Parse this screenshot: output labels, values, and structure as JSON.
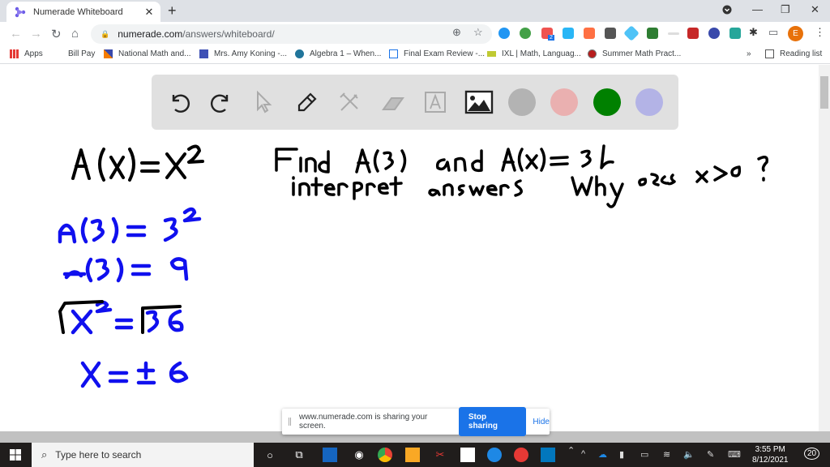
{
  "browser": {
    "tab_title": "Numerade Whiteboard",
    "url_host": "numerade.com",
    "url_path": "/answers/whiteboard/",
    "profile_initial": "E",
    "extension_badge": "2"
  },
  "bookmarks": [
    {
      "label": "Apps",
      "icon": "apps-grid-icon"
    },
    {
      "label": "Bill Pay",
      "icon": ""
    },
    {
      "label": "National Math and...",
      "icon": "national-math-icon"
    },
    {
      "label": "Mrs. Amy Koning -...",
      "icon": "calendar-icon"
    },
    {
      "label": "Algebra 1 – When...",
      "icon": "wordpress-icon"
    },
    {
      "label": "Final Exam Review -...",
      "icon": "forms-icon"
    },
    {
      "label": "IXL | Math, Languag...",
      "icon": "ixl-icon"
    },
    {
      "label": "Summer Math Pract...",
      "icon": "summer-math-icon"
    }
  ],
  "bookmarks_overflow": "»",
  "reading_list": "Reading list",
  "whiteboard": {
    "tools": [
      "undo",
      "redo",
      "select",
      "pen",
      "tools",
      "eraser",
      "text",
      "image"
    ],
    "colors": [
      "#b3b3b3",
      "#eab0b0",
      "#008000",
      "#b3b3e6"
    ],
    "handwriting": {
      "black_line1": "A(x) = x²",
      "prompt_line1": "Find A(3) and A(x) = 36",
      "prompt_line2": "interpret answers   Why does x>0 ?",
      "blue_lines": [
        "A(3) = 3²",
        "A(3) = 9",
        "√x² = √36",
        "x = ±6"
      ]
    }
  },
  "share_bar": {
    "message": "www.numerade.com is sharing your screen.",
    "stop_label": "Stop sharing",
    "hide_label": "Hide"
  },
  "taskbar": {
    "search_placeholder": "Type here to search",
    "time": "3:55 PM",
    "date": "8/12/2021",
    "notification_count": "20"
  }
}
